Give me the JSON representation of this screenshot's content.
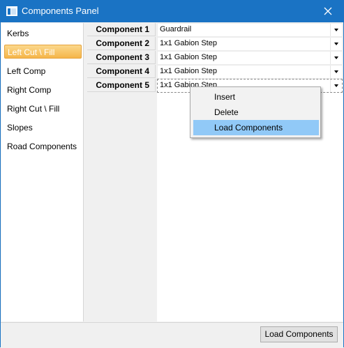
{
  "window": {
    "title": "Components Panel",
    "icon": "window-icon",
    "close_icon": "close-icon"
  },
  "sidebar": {
    "items": [
      {
        "label": "Kerbs",
        "selected": false
      },
      {
        "label": "Left Cut \\ Fill",
        "selected": true
      },
      {
        "label": "Left Comp",
        "selected": false
      },
      {
        "label": "Right Comp",
        "selected": false
      },
      {
        "label": "Right Cut \\ Fill",
        "selected": false
      },
      {
        "label": "Slopes",
        "selected": false
      },
      {
        "label": "Road Components",
        "selected": false
      }
    ]
  },
  "components": [
    {
      "label": "Component 1",
      "value": "Guardrail"
    },
    {
      "label": "Component 2",
      "value": "1x1 Gabion Step"
    },
    {
      "label": "Component 3",
      "value": "1x1 Gabion Step"
    },
    {
      "label": "Component 4",
      "value": "1x1 Gabion Step"
    },
    {
      "label": "Component 5",
      "value": "1x1 Gabion Step"
    }
  ],
  "context_menu": {
    "items": [
      {
        "label": "Insert",
        "highlighted": false
      },
      {
        "label": "Delete",
        "highlighted": false
      },
      {
        "label": "Load Components",
        "highlighted": true
      }
    ]
  },
  "footer": {
    "load_button_label": "Load Components"
  },
  "colors": {
    "titlebar": "#1a73c4",
    "selected_item": "#f5b549",
    "menu_highlight": "#91c9f7"
  }
}
